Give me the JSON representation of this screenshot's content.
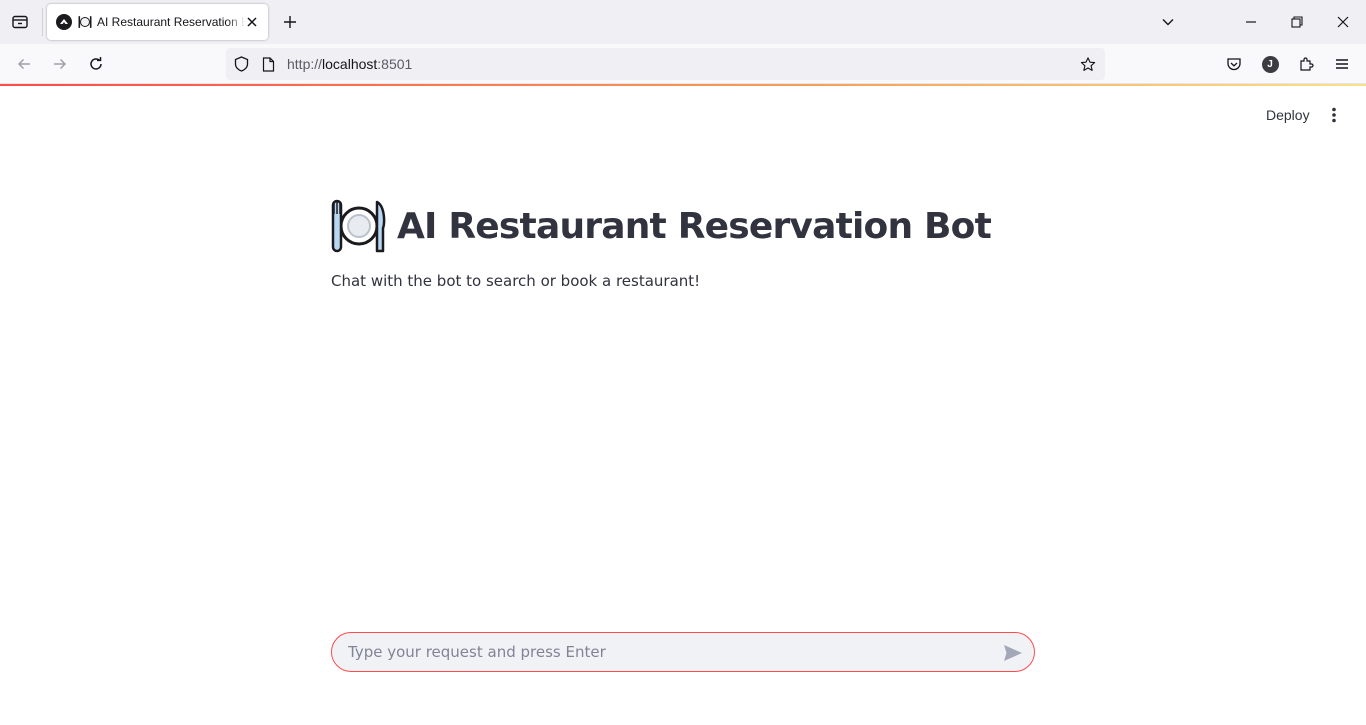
{
  "browser": {
    "tab_title": "AI Restaurant Reservation Bot",
    "url_scheme": "http://",
    "url_host": "localhost",
    "url_port": ":8501",
    "profile_initial": "J"
  },
  "app": {
    "deploy_label": "Deploy",
    "title": "AI Restaurant Reservation Bot",
    "subtitle": "Chat with the bot to search or book a restaurant!",
    "chat_placeholder": "Type your request and press Enter"
  },
  "colors": {
    "accent": "#ff4b4b",
    "text": "#31333f",
    "input_bg": "#f0f2f6"
  },
  "icons": {
    "title": "fork-knife-plate-icon",
    "send": "send-icon"
  }
}
